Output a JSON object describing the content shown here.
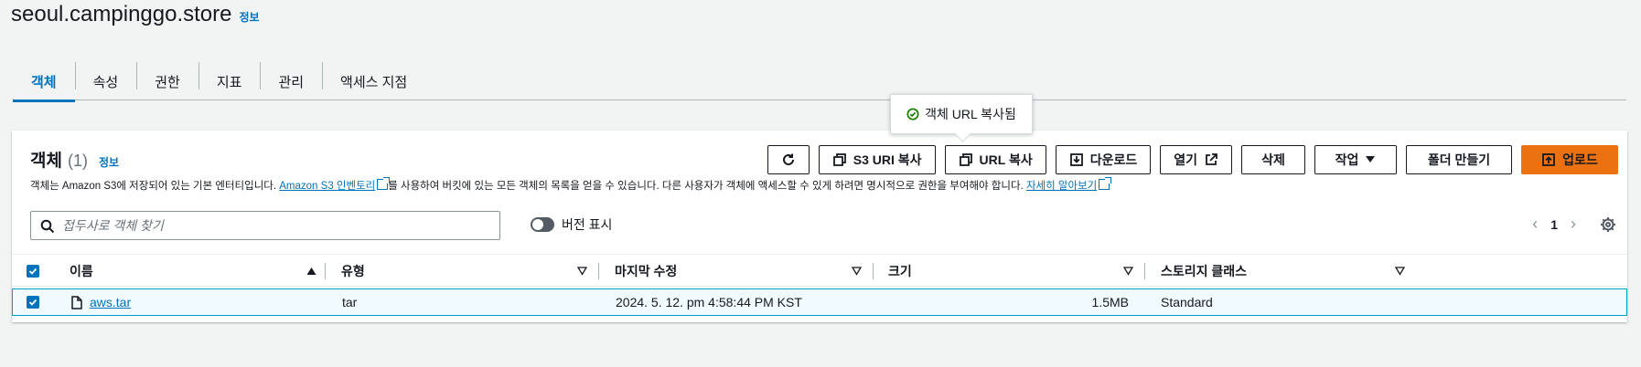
{
  "bucket": {
    "title": "seoul.campinggo.store",
    "info": "정보"
  },
  "tabs": [
    {
      "label": "객체",
      "active": true
    },
    {
      "label": "속성"
    },
    {
      "label": "권한"
    },
    {
      "label": "지표"
    },
    {
      "label": "관리"
    },
    {
      "label": "액세스 지점"
    }
  ],
  "toast": {
    "text": "객체 URL 복사됨"
  },
  "objects": {
    "title": "객체",
    "count": "(1)",
    "info": "정보",
    "desc_pre": "객체는 Amazon S3에 저장되어 있는 기본 엔터티입니다. ",
    "desc_link1": "Amazon S3 인벤토리",
    "desc_mid": "를 사용하여 버킷에 있는 모든 객체의 목록을 얻을 수 있습니다. 다른 사용자가 객체에 액세스할 수 있게 하려면 명시적으로 권한을 부여해야 합니다. ",
    "desc_link2": "자세히 알아보기"
  },
  "actions": {
    "refresh_icon": "refresh-icon",
    "s3_uri_copy": "S3 URI 복사",
    "url_copy": "URL 복사",
    "download": "다운로드",
    "open": "열기",
    "delete": "삭제",
    "actions": "작업",
    "create_folder": "폴더 만들기",
    "upload": "업로드"
  },
  "search": {
    "placeholder": "접두사로 객체 찾기"
  },
  "version_toggle": {
    "label": "버전 표시",
    "on": false
  },
  "pagination": {
    "page": "1"
  },
  "columns": {
    "name": "이름",
    "type": "유형",
    "modified": "마지막 수정",
    "size": "크기",
    "storage_class": "스토리지 클래스"
  },
  "rows": [
    {
      "name": "aws.tar",
      "type": "tar",
      "modified": "2024. 5. 12. pm 4:58:44 PM KST",
      "size": "1.5MB",
      "storage_class": "Standard",
      "selected": true
    }
  ],
  "colors": {
    "accent": "#0073bb",
    "primary": "#ec7211",
    "success": "#1d8102"
  }
}
